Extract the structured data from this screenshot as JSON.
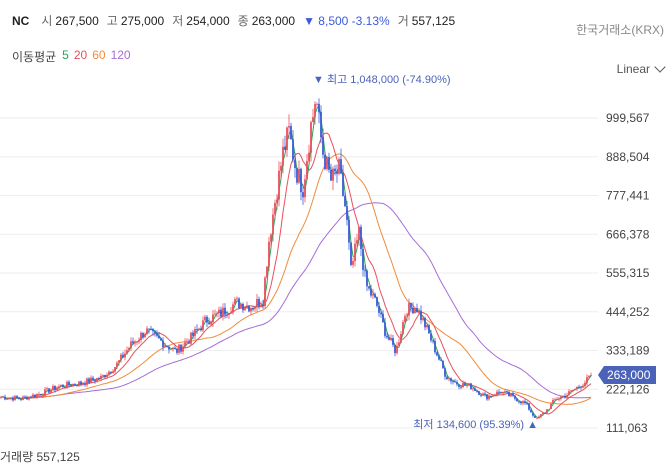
{
  "header": {
    "symbol": "NC",
    "open_label": "시",
    "open": "267,500",
    "high_label": "고",
    "high": "275,000",
    "low_label": "저",
    "low": "254,000",
    "close_label": "종",
    "close": "263,000",
    "change": "▼ 8,500 -3.13%",
    "volume_label": "거",
    "volume": "557,125"
  },
  "exchange": "한국거래소(KRX)",
  "ma": {
    "label": "이동평균",
    "p5": "5",
    "p20": "20",
    "p60": "60",
    "p120": "120"
  },
  "scale_mode": "Linear",
  "colors": {
    "ma5": "#2ca05a",
    "ma20": "#e8505b",
    "ma60": "#f08c3c",
    "ma120": "#a66dd8",
    "up": "#e8505b",
    "down": "#3a5bd9",
    "price_tag": "#4a63b8"
  },
  "bottom_text": "거래량 557,125",
  "chart_data": {
    "type": "candlestick",
    "y_ticks": [
      "999,567",
      "888,504",
      "777,441",
      "666,378",
      "555,315",
      "444,252",
      "333,189",
      "222,126",
      "111,063"
    ],
    "y_tick_values": [
      999567,
      888504,
      777441,
      666378,
      555315,
      444252,
      333189,
      222126,
      111063
    ],
    "ylim": [
      85000,
      1140000
    ],
    "grid": true,
    "last_price_label": "263,000",
    "last_price": 263000,
    "max_annotation": "▼ 최고 1,048,000 (-74.90%)",
    "max_value": 1048000,
    "min_annotation": "최저 134,600 (95.39%) ▲",
    "min_value": 134600,
    "series_names": [
      "5",
      "20",
      "60",
      "120"
    ],
    "price_path": [
      [
        0,
        200000
      ],
      [
        20,
        195000
      ],
      [
        40,
        210000
      ],
      [
        60,
        232000
      ],
      [
        80,
        240000
      ],
      [
        100,
        255000
      ],
      [
        115,
        290000
      ],
      [
        130,
        350000
      ],
      [
        145,
        390000
      ],
      [
        160,
        360000
      ],
      [
        175,
        330000
      ],
      [
        190,
        370000
      ],
      [
        205,
        420000
      ],
      [
        220,
        440000
      ],
      [
        235,
        470000
      ],
      [
        250,
        460000
      ],
      [
        262,
        480000
      ],
      [
        268,
        650000
      ],
      [
        275,
        780000
      ],
      [
        282,
        900000
      ],
      [
        288,
        960000
      ],
      [
        295,
        850000
      ],
      [
        302,
        800000
      ],
      [
        310,
        980000
      ],
      [
        315,
        1048000
      ],
      [
        322,
        900000
      ],
      [
        330,
        820000
      ],
      [
        338,
        850000
      ],
      [
        345,
        730000
      ],
      [
        350,
        560000
      ],
      [
        358,
        670000
      ],
      [
        365,
        520000
      ],
      [
        375,
        470000
      ],
      [
        385,
        380000
      ],
      [
        395,
        330000
      ],
      [
        405,
        450000
      ],
      [
        415,
        460000
      ],
      [
        425,
        400000
      ],
      [
        435,
        330000
      ],
      [
        445,
        260000
      ],
      [
        455,
        240000
      ],
      [
        470,
        230000
      ],
      [
        485,
        200000
      ],
      [
        500,
        215000
      ],
      [
        515,
        195000
      ],
      [
        525,
        180000
      ],
      [
        535,
        134600
      ],
      [
        545,
        160000
      ],
      [
        555,
        195000
      ],
      [
        565,
        205000
      ],
      [
        575,
        225000
      ],
      [
        585,
        245000
      ],
      [
        590,
        263000
      ]
    ]
  }
}
